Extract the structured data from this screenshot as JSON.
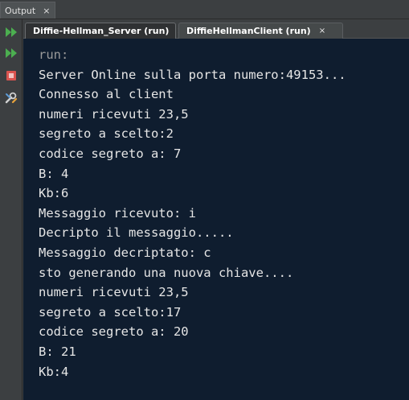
{
  "window": {
    "title": "Output",
    "close_glyph": "×"
  },
  "toolbar": {
    "buttons": [
      {
        "name": "rerun-icon",
        "color": "#4caf50"
      },
      {
        "name": "rerun-with-options-icon",
        "color": "#4caf50"
      },
      {
        "name": "stop-icon",
        "color": "#e04040"
      },
      {
        "name": "settings-icon",
        "color": "#cccccc"
      }
    ]
  },
  "tabs": [
    {
      "label": "Diffie-Hellman_Server (run)",
      "close_glyph": "×",
      "active": true
    },
    {
      "label": "DiffieHellmanClient (run)",
      "close_glyph": "×",
      "active": false
    }
  ],
  "output": {
    "lines": [
      "run:",
      "Server Online sulla porta numero:49153...",
      "Connesso al client",
      "numeri ricevuti 23,5",
      "segreto a scelto:2",
      "codice segreto a: 7",
      "B: 4",
      "Kb:6",
      "Messaggio ricevuto: i",
      "Decripto il messaggio.....",
      "Messaggio decriptato: c",
      "sto generando una nuova chiave....",
      "numeri ricevuti 23,5",
      "segreto a scelto:17",
      "codice segreto a: 20",
      "B: 21",
      "Kb:4"
    ]
  },
  "colors": {
    "output_background": "#0f1d2f",
    "output_text": "#e6e6e6",
    "run_text": "#9a9a9a"
  }
}
